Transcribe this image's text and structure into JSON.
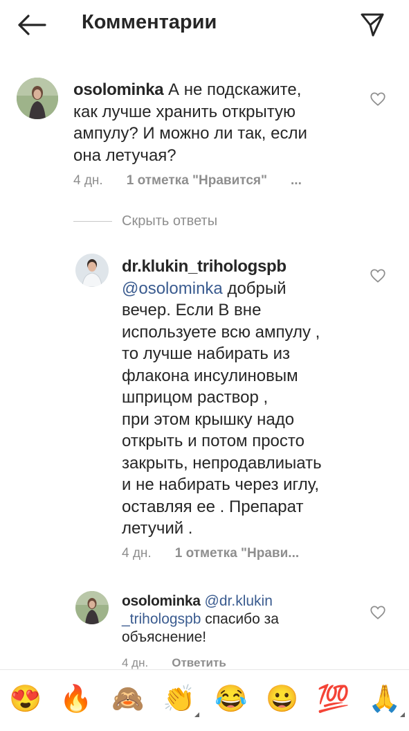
{
  "header": {
    "title": "Комментарии",
    "back_icon": "arrow-left-icon",
    "share_icon": "paper-plane-icon"
  },
  "comments": [
    {
      "username": "osolominka",
      "text_lines": [
        "А не подскажите,",
        "как лучше хранить открытую",
        "ампулу? И можно ли так, если",
        "она летучая?"
      ],
      "time": "4 дн.",
      "likes": "1 отметка \"Нравится\"",
      "more": "..."
    }
  ],
  "hide_replies_label": "Скрыть ответы",
  "replies": [
    {
      "username": "dr.klukin_trihologspb",
      "mention": "@osolominka",
      "first_line_rest": "добрый",
      "text_lines": [
        "вечер. Если В вне",
        "используете всю ампулу ,",
        "то лучше набирать из",
        "флакона инсулиновым",
        "шприцом раствор ,",
        "при этом крышку надо",
        "открыть и потом просто",
        "закрыть, непродавлиыать",
        "и не набирать через иглу,",
        "оставляя ее . Препарат",
        "летучий ."
      ],
      "time": "4 дн.",
      "likes": "1 отметка \"Нрави..."
    },
    {
      "username": "osolominka",
      "mention_part1": "@dr.klukin",
      "mention_part2": "_trihologspb",
      "text_after_mention": "спасибо за",
      "text_last": "объяснение!",
      "time": "4 дн.",
      "reply": "Ответить"
    }
  ],
  "emoji_bar": [
    "😍",
    "🔥",
    "🙈",
    "👏",
    "😂",
    "😀",
    "💯",
    "🙏"
  ]
}
